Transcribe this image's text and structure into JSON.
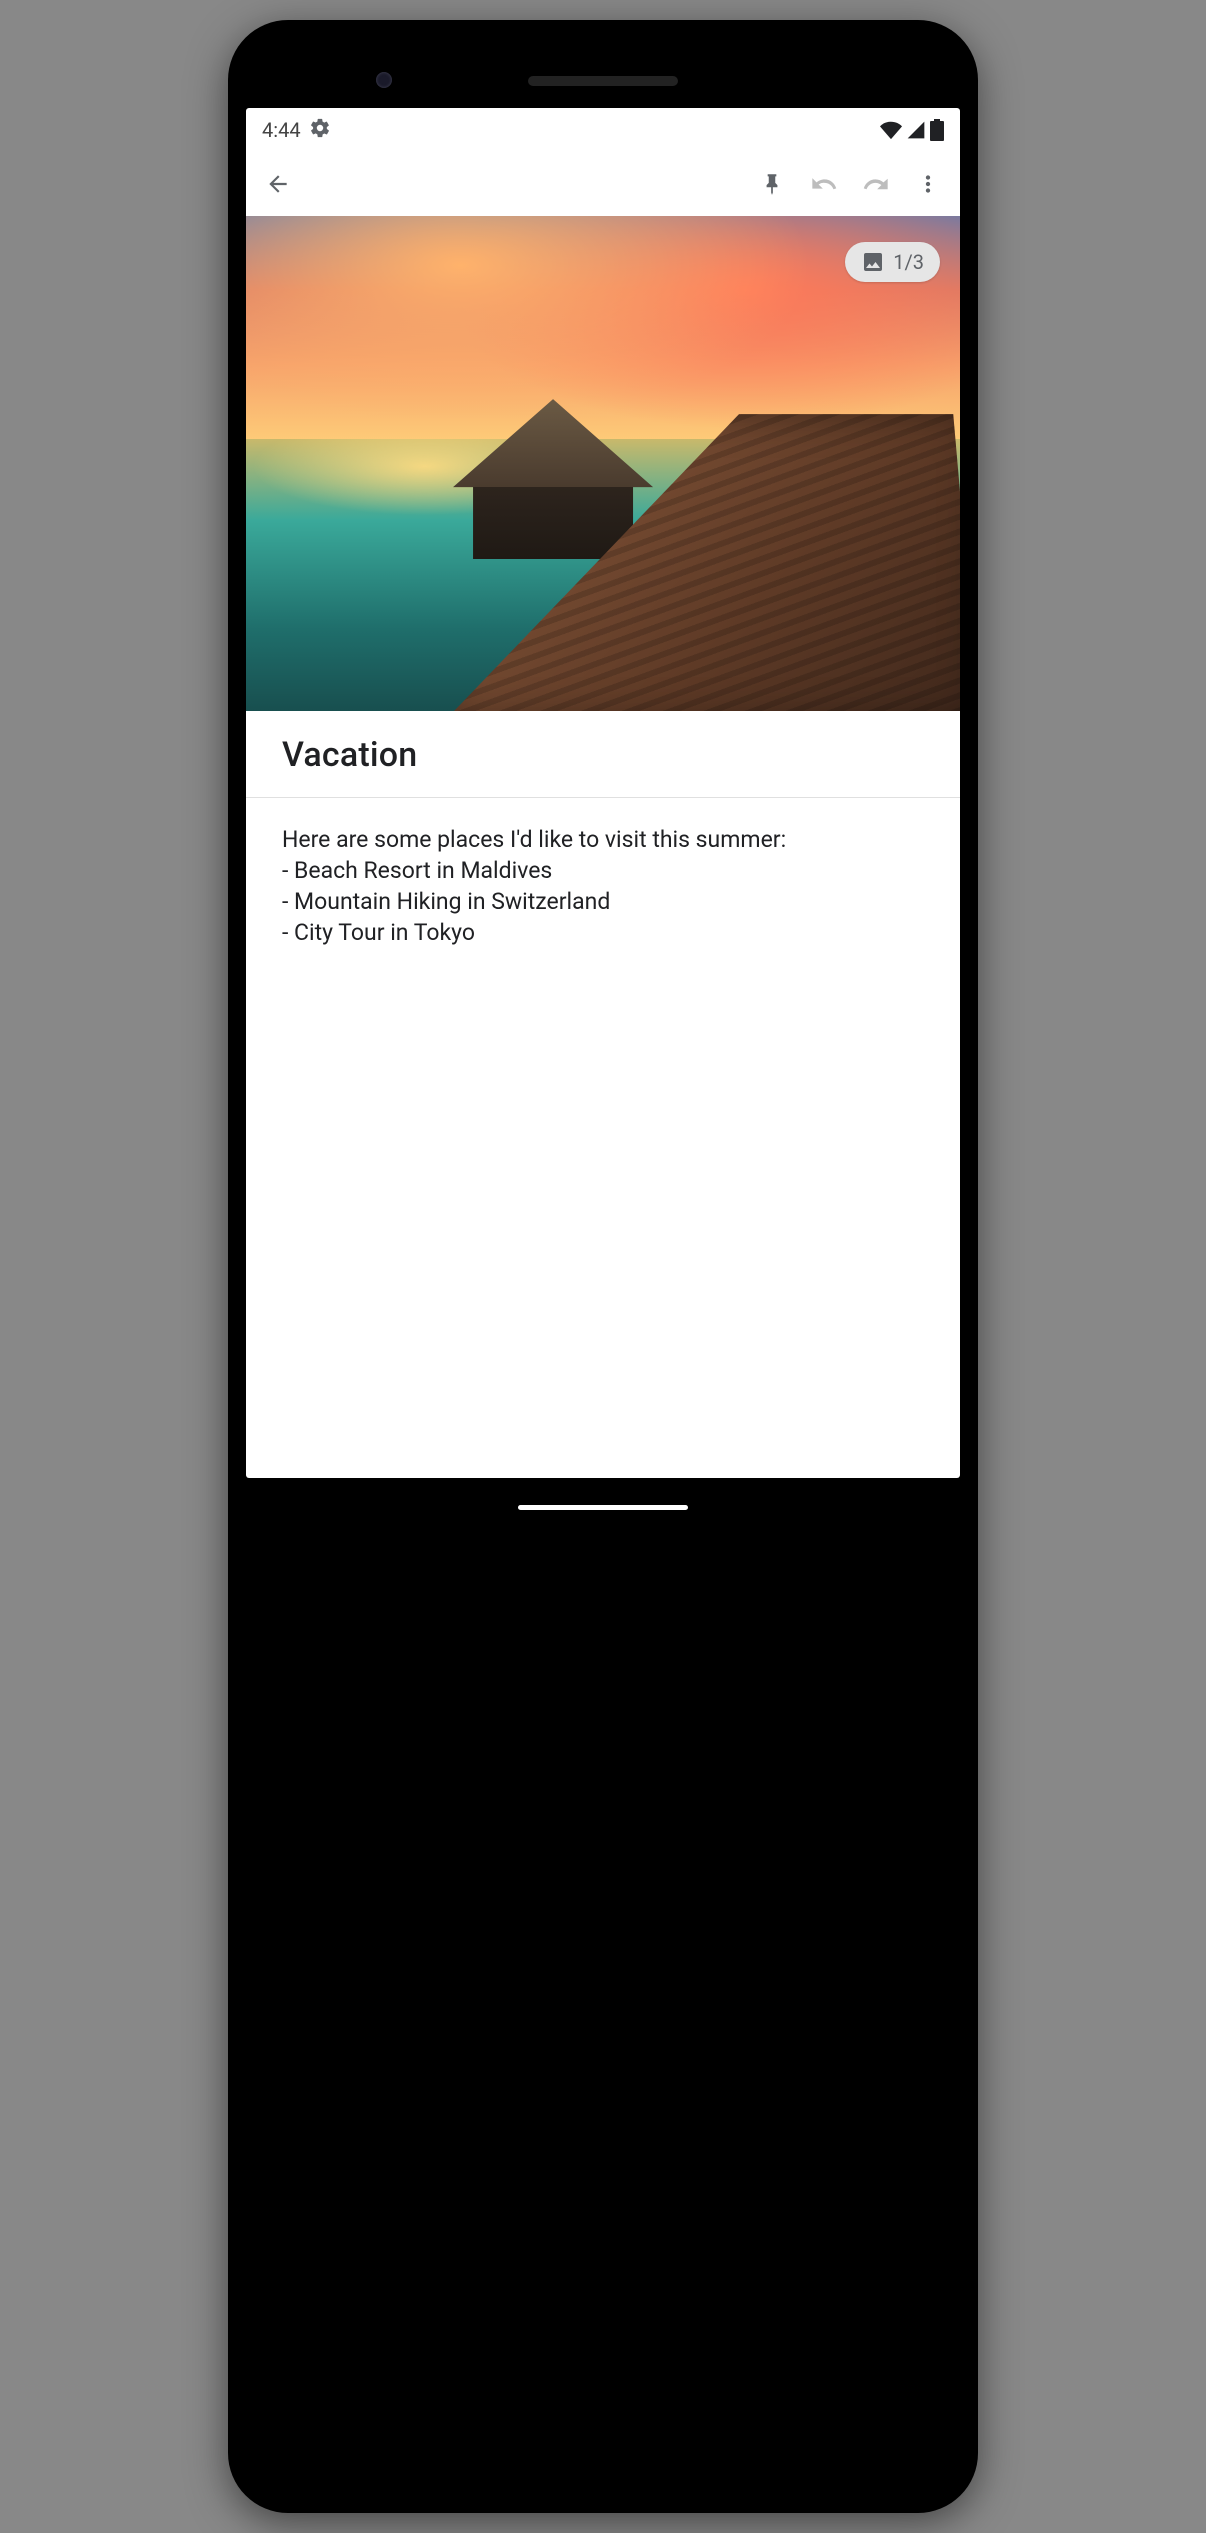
{
  "status": {
    "time": "4:44",
    "gear_icon": "gear-icon",
    "wifi_icon": "wifi-icon",
    "signal_icon": "signal-icon",
    "battery_icon": "battery-icon"
  },
  "appbar": {
    "back": "back",
    "pin": "pin",
    "undo": "undo",
    "redo": "redo",
    "overflow": "more"
  },
  "hero": {
    "image_alt": "Overwater bungalow resort at sunset with wooden boardwalk over turquoise sea",
    "counter": "1/3"
  },
  "note": {
    "title": "Vacation",
    "body": "Here are some places I'd like to visit this summer:\n- Beach Resort in Maldives\n- Mountain Hiking in Switzerland\n- City Tour in Tokyo"
  }
}
